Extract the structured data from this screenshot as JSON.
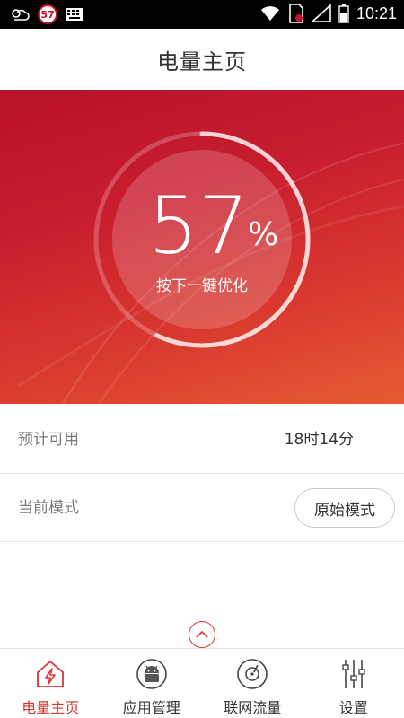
{
  "status_bar": {
    "badge": "57",
    "time": "10:21"
  },
  "header": {
    "title": "电量主页"
  },
  "battery": {
    "percent": "57",
    "percent_sign": "%",
    "hint": "按下一键优化",
    "level": 0.57
  },
  "estimate": {
    "label": "预计可用",
    "value": "18时14分"
  },
  "mode": {
    "label": "当前模式",
    "button": "原始模式"
  },
  "tabs": [
    {
      "label": "电量主页",
      "icon": "home-battery-icon",
      "active": true
    },
    {
      "label": "应用管理",
      "icon": "android-app-icon",
      "active": false
    },
    {
      "label": "联网流量",
      "icon": "traffic-disc-icon",
      "active": false
    },
    {
      "label": "设置",
      "icon": "settings-sliders-icon",
      "active": false
    }
  ],
  "colors": {
    "accent": "#d8362e",
    "hero_top": "#b8122a",
    "hero_bottom": "#e65a33"
  }
}
